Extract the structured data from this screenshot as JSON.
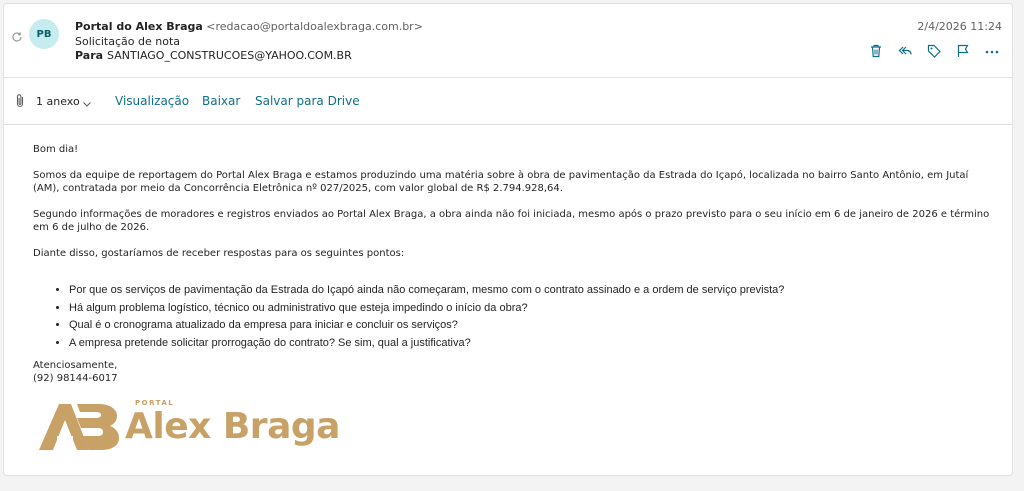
{
  "header": {
    "avatar_initials": "PB",
    "sender_name": "Portal do Alex Braga",
    "sender_email": "<redacao@portaldoalexbraga.com.br>",
    "subject": "Solicitação de nota",
    "to_label": "Para",
    "to_value": "SANTIAGO_CONSTRUCOES@YAHOO.COM.BR",
    "date": "2/4/2026 11:24"
  },
  "actions": [
    "trash-icon",
    "reply-all-icon",
    "tag-icon",
    "flag-icon",
    "more-icon"
  ],
  "attachments": {
    "count_label": "1 anexo",
    "preview_label": "Visualização",
    "download_label": "Baixar",
    "save_drive_label": "Salvar para Drive"
  },
  "body": {
    "greeting": "Bom dia!",
    "p1": "Somos da equipe de reportagem do Portal Alex Braga e estamos produzindo uma matéria sobre  à obra de pavimentação da Estrada do Içapó, localizada no bairro Santo Antônio, em Jutaí (AM), contratada por meio da Concorrência Eletrônica nº 027/2025, com valor global de R$ 2.794.928,64.",
    "p2": "Segundo informações de moradores e registros enviados ao Portal Alex Braga, a obra ainda não foi iniciada, mesmo após o prazo previsto para o seu início em 6 de janeiro de 2026 e término em 6 de julho de 2026.",
    "p3": "Diante disso, gostaríamos de receber respostas para os seguintes pontos:",
    "questions": [
      "Por que os serviços de pavimentação da Estrada do Içapó ainda não começaram, mesmo com o contrato assinado e a ordem de serviço prevista?",
      "Há algum problema logístico, técnico ou administrativo que esteja impedindo o início da obra?",
      "Qual é o cronograma atualizado da empresa para iniciar e concluir os serviços?",
      "A empresa pretende solicitar prorrogação do contrato? Se sim, qual a justificativa?"
    ],
    "closing": "Atenciosamente,",
    "phone": "(92) 98144-6017"
  },
  "logo": {
    "portal_text": "PORTAL",
    "name_text": "Alex Braga",
    "color": "#c8a167"
  },
  "colors": {
    "accent": "#0f6f8a",
    "avatar_bg": "#c7ecef"
  }
}
